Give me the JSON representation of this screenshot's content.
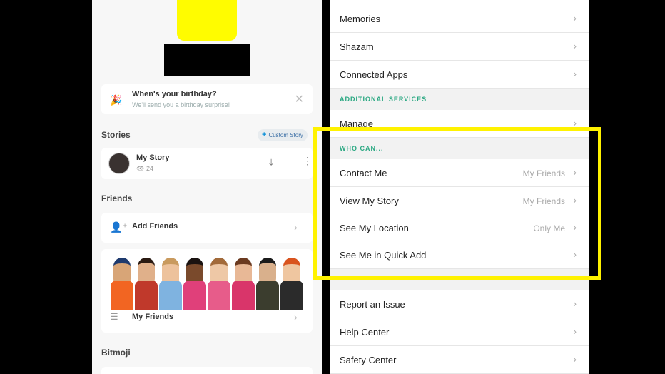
{
  "left": {
    "birthday": {
      "title": "When's your birthday?",
      "subtitle": "We'll send you a birthday surprise!"
    },
    "stories_title": "Stories",
    "custom_story": "Custom Story",
    "my_story": {
      "title": "My Story",
      "views": "24"
    },
    "friends_title": "Friends",
    "add_friends": "Add Friends",
    "my_friends": "My Friends",
    "bitmoji_title": "Bitmoji"
  },
  "right": {
    "rows_top": [
      {
        "label": "Memories"
      },
      {
        "label": "Shazam"
      },
      {
        "label": "Connected Apps"
      }
    ],
    "additional_header": "ADDITIONAL SERVICES",
    "manage": "Manage",
    "who_can_header": "WHO CAN...",
    "who_can_rows": [
      {
        "label": "Contact Me",
        "value": "My Friends"
      },
      {
        "label": "View My Story",
        "value": "My Friends"
      },
      {
        "label": "See My Location",
        "value": "Only Me"
      },
      {
        "label": "See Me in Quick Add",
        "value": ""
      }
    ],
    "rows_bottom": [
      {
        "label": "Report an Issue"
      },
      {
        "label": "Help Center"
      },
      {
        "label": "Safety Center"
      }
    ]
  },
  "colors": {
    "accent_yellow": "#fff200",
    "section_green": "#2aa882",
    "snap_yellow": "#fffc00"
  }
}
